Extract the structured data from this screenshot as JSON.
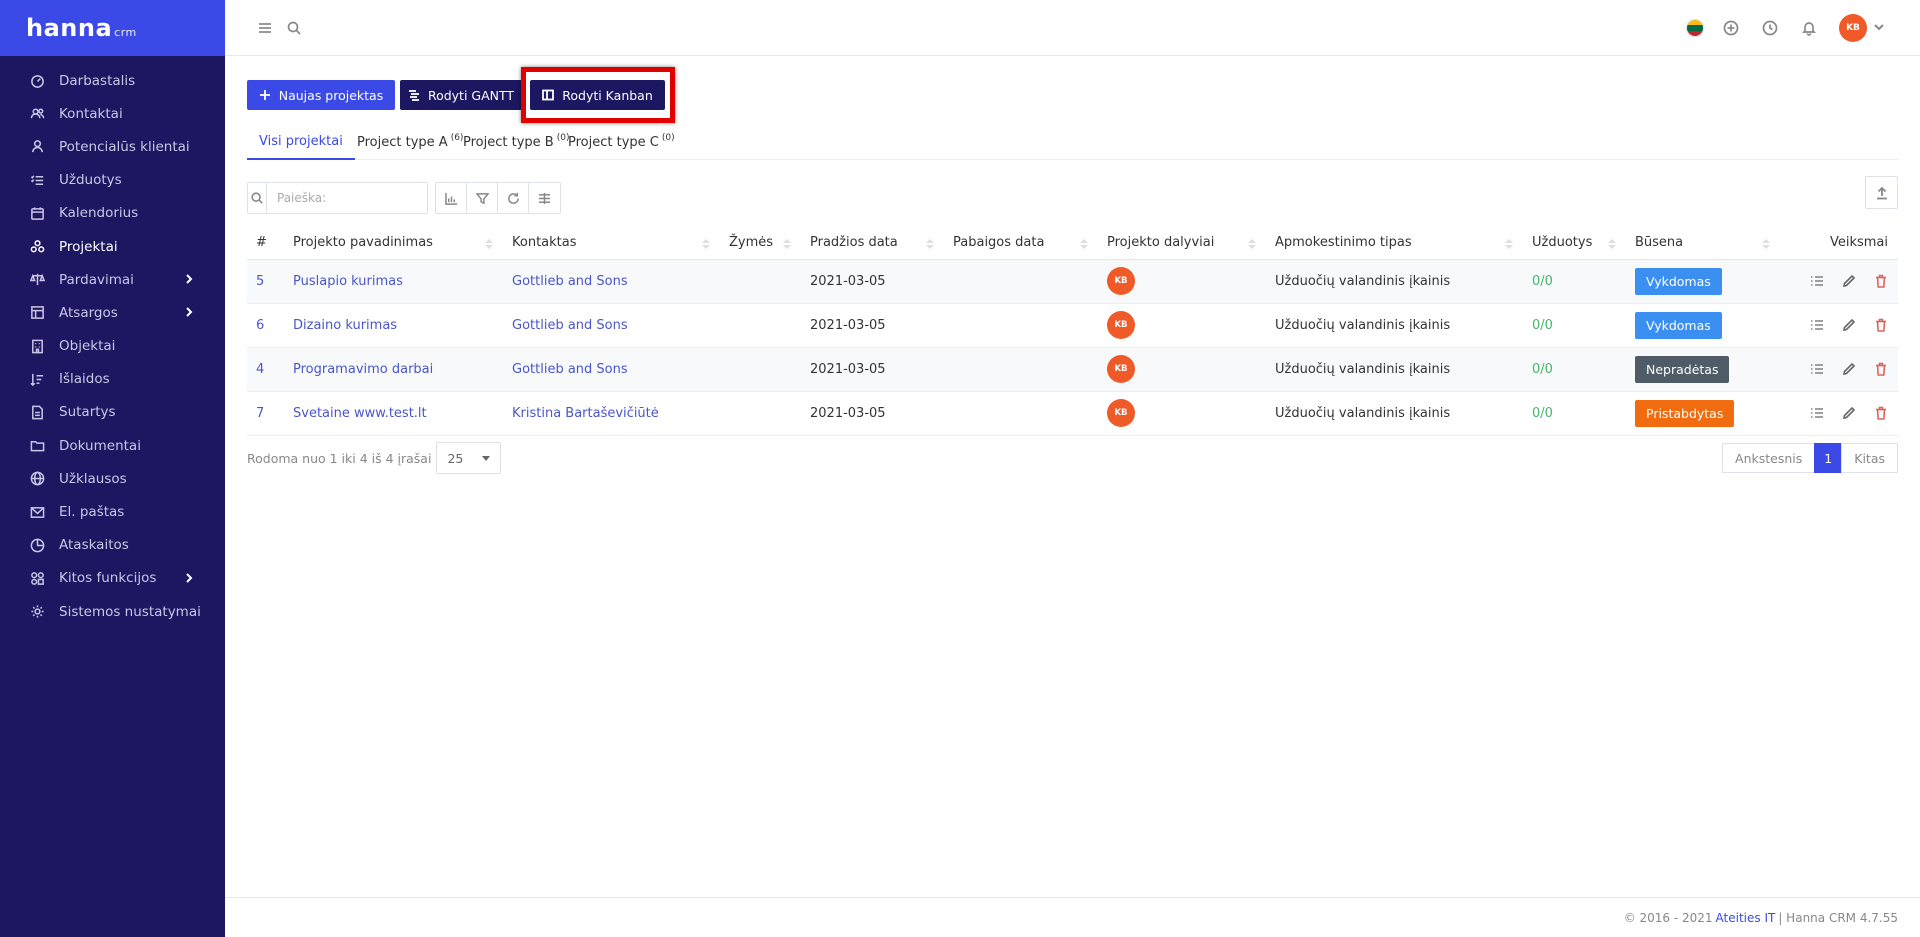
{
  "app": {
    "logo_main": "hanna",
    "logo_suffix": "crm"
  },
  "sidebar": {
    "items": [
      {
        "label": "Darbastalis",
        "icon": "dashboard-icon"
      },
      {
        "label": "Kontaktai",
        "icon": "users-icon"
      },
      {
        "label": "Potencialūs klientai",
        "icon": "leads-icon"
      },
      {
        "label": "Užduotys",
        "icon": "tasks-icon"
      },
      {
        "label": "Kalendorius",
        "icon": "calendar-icon"
      },
      {
        "label": "Projektai",
        "icon": "projects-icon"
      },
      {
        "label": "Pardavimai",
        "icon": "sales-icon"
      },
      {
        "label": "Atsargos",
        "icon": "inventory-icon"
      },
      {
        "label": "Objektai",
        "icon": "building-icon"
      },
      {
        "label": "Išlaidos",
        "icon": "expenses-icon"
      },
      {
        "label": "Sutartys",
        "icon": "contract-icon"
      },
      {
        "label": "Dokumentai",
        "icon": "folder-icon"
      },
      {
        "label": "Užklausos",
        "icon": "globe-icon"
      },
      {
        "label": "El. paštas",
        "icon": "mail-icon"
      },
      {
        "label": "Ataskaitos",
        "icon": "reports-icon"
      },
      {
        "label": "Kitos funkcijos",
        "icon": "modules-icon"
      },
      {
        "label": "Sistemos nustatymai",
        "icon": "gear-icon"
      }
    ]
  },
  "topbar": {
    "avatar_initials": "KB"
  },
  "buttons": {
    "new_project": "Naujas projektas",
    "show_gantt": "Rodyti GANTT",
    "show_kanban": "Rodyti Kanban"
  },
  "tabs": [
    {
      "label": "Visi projektai",
      "count": ""
    },
    {
      "label": "Project type A",
      "count": "(6)"
    },
    {
      "label": "Project type B",
      "count": "(0)"
    },
    {
      "label": "Project type C",
      "count": "(0)"
    }
  ],
  "search": {
    "placeholder": "Paieška:"
  },
  "table": {
    "headers": [
      "#",
      "Projekto pavadinimas",
      "Kontaktas",
      "Žymės",
      "Pradžios data",
      "Pabaigos data",
      "Projekto dalyviai",
      "Apmokestinimo tipas",
      "Užduotys",
      "Būsena",
      "Veiksmai"
    ],
    "rows": [
      {
        "id": "5",
        "name": "Puslapio kurimas",
        "contact": "Gottlieb and Sons",
        "tags": "",
        "start": "2021-03-05",
        "end": "",
        "member": "KB",
        "billing": "Užduočių valandinis įkainis",
        "tasks": "0/0",
        "status": "Vykdomas",
        "status_color": "#3b8ff0"
      },
      {
        "id": "6",
        "name": "Dizaino kurimas",
        "contact": "Gottlieb and Sons",
        "tags": "",
        "start": "2021-03-05",
        "end": "",
        "member": "KB",
        "billing": "Užduočių valandinis įkainis",
        "tasks": "0/0",
        "status": "Vykdomas",
        "status_color": "#3b8ff0"
      },
      {
        "id": "4",
        "name": "Programavimo darbai",
        "contact": "Gottlieb and Sons",
        "tags": "",
        "start": "2021-03-05",
        "end": "",
        "member": "KB",
        "billing": "Užduočių valandinis įkainis",
        "tasks": "0/0",
        "status": "Nepradėtas",
        "status_color": "#4f5b66"
      },
      {
        "id": "7",
        "name": "Svetaine www.test.lt",
        "contact": "Kristina Bartaševičiūtė",
        "tags": "",
        "start": "2021-03-05",
        "end": "",
        "member": "KB",
        "billing": "Užduočių valandinis įkainis",
        "tasks": "0/0",
        "status": "Pristabdytas",
        "status_color": "#f06c0f"
      }
    ]
  },
  "pager": {
    "info": "Rodoma nuo 1 iki 4 iš 4 įrašai",
    "per_page": "25",
    "prev": "Ankstesnis",
    "current": "1",
    "next": "Kitas"
  },
  "footer": {
    "copyright": "© 2016 - 2021",
    "company": "Ateities IT",
    "version": "| Hanna CRM 4.7.55"
  },
  "colors": {
    "sidebar_bg": "#1d1661",
    "accent": "#3b49e6",
    "highlight": "#e10000"
  }
}
